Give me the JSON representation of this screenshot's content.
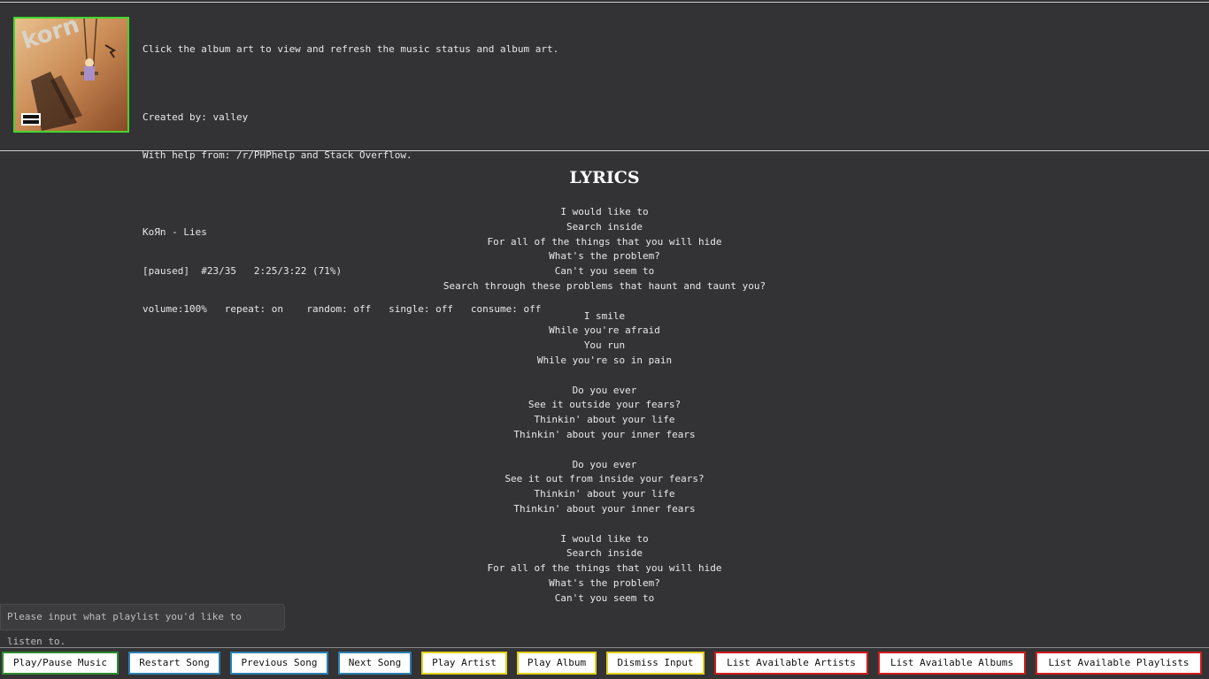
{
  "colors": {
    "background": "#333335",
    "art_border": "#44d62c",
    "green": "#2e8b2e",
    "blue": "#2d7fb0",
    "yellow": "#e0d21a",
    "red": "#d11b1b"
  },
  "status": {
    "hint": "Click the album art to view and refresh the music status and album art.",
    "created_by": "Created by: valley",
    "help_from": "With help from: /r/PHPhelp and Stack Overflow.",
    "track": "KoЯn - Lies",
    "playback": "[paused]  #23/35   2:25/3:22 (71%)",
    "options": "volume:100%   repeat: on    random: off   single: off   consume: off"
  },
  "lyrics": {
    "title": "LYRICS",
    "lines": [
      "I would like to",
      "Search inside",
      "For all of the things that you will hide",
      "What's the problem?",
      "Can't you seem to",
      "Search through these problems that haunt and taunt you?",
      "",
      "I smile",
      "While you're afraid",
      "You run",
      "While you're so in pain",
      "",
      "Do you ever",
      "See it outside your fears?",
      "Thinkin' about your life",
      "Thinkin' about your inner fears",
      "",
      "Do you ever",
      "See it out from inside your fears?",
      "Thinkin' about your life",
      "Thinkin' about your inner fears",
      "",
      "I would like to",
      "Search inside",
      "For all of the things that you will hide",
      "What's the problem?",
      "Can't you seem to"
    ]
  },
  "prompt": {
    "text": "Please input what playlist you'd like to listen to."
  },
  "buttons": {
    "play_pause": "Play/Pause Music",
    "restart": "Restart Song",
    "previous": "Previous Song",
    "next": "Next Song",
    "play_artist": "Play Artist",
    "play_album": "Play Album",
    "dismiss": "Dismiss Input",
    "list_artists": "List Available Artists",
    "list_albums": "List Available Albums",
    "list_playlists": "List Available Playlists"
  }
}
